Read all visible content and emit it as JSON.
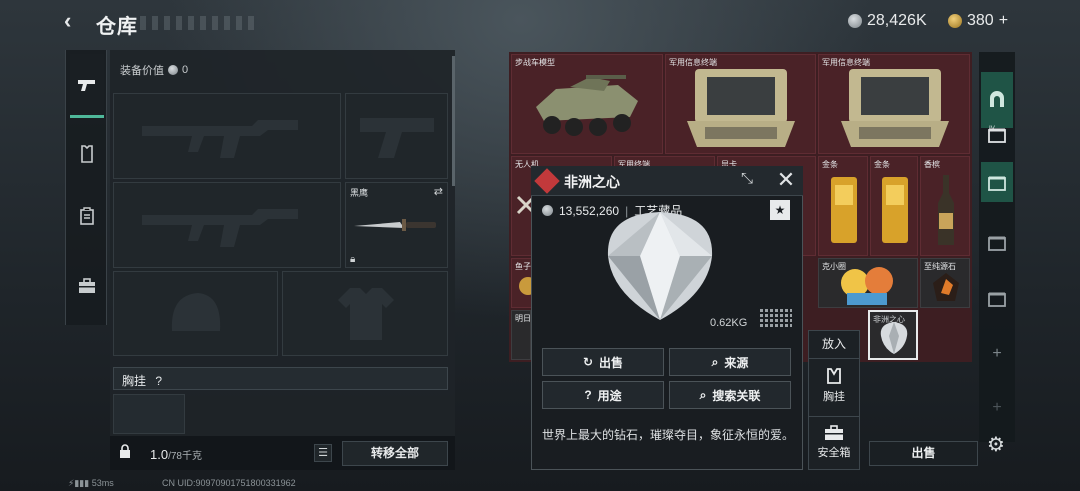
{
  "header": {
    "title": "仓库",
    "silver": "28,426K",
    "gold": "380",
    "gold_plus": "+"
  },
  "equipment": {
    "value_label": "装备价值",
    "value": "0",
    "knife_name": "黑鹰",
    "chest_rig_label": "胸挂",
    "chest_rig_hint": "?",
    "weight_current": "1.0",
    "weight_capacity": "/78千克",
    "move_all_label": "转移全部"
  },
  "stash": {
    "items": [
      {
        "name": "步战车模型"
      },
      {
        "name": "军用信息终端"
      },
      {
        "name": "军用信息终端"
      },
      {
        "name": "无人机"
      },
      {
        "name": "军用终端"
      },
      {
        "name": "显卡"
      },
      {
        "name": "金条"
      },
      {
        "name": "金条"
      },
      {
        "name": "香槟"
      },
      {
        "name": "鱼子"
      },
      {
        "name": "克小圈"
      },
      {
        "name": "至纯源石"
      },
      {
        "name": "明日"
      },
      {
        "name": "非洲之心"
      }
    ]
  },
  "popup": {
    "title": "非洲之心",
    "price": "13,552,260",
    "category": "工艺藏品",
    "weight": "0.62KG",
    "buttons": {
      "sell": "出售",
      "source": "来源",
      "usage": "用途",
      "search": "搜索关联"
    },
    "description": "世界上最大的钻石，璀璨夺目，象征永恒的爱。"
  },
  "side_menu": {
    "put_in": "放入",
    "chest_rig": "胸挂",
    "safe_box": "安全箱"
  },
  "sell_label": "出售",
  "footer": {
    "ping": "53ms",
    "uid": "CN UID:909709017518003319​62"
  },
  "colors": {
    "accent_teal": "#1f5446",
    "stash_bg": "#3d1e22",
    "rarity_red": "#c2393b"
  }
}
